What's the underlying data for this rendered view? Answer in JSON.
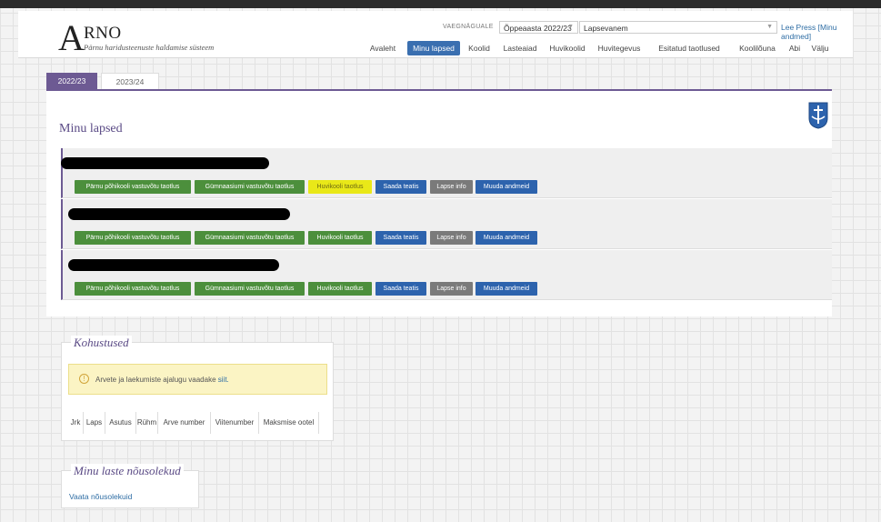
{
  "app": {
    "logo_letter": "A",
    "logo_name": "RNO",
    "subtitle": "Pärnu haridusteenuste haldamise süsteem"
  },
  "view": {
    "label": "VAEGNÄGUALE",
    "year": "Õppeaasta 2022/23",
    "role": "Lapsevanem",
    "user": "Lee Press [Minu andmed]"
  },
  "nav": [
    "Avaleht",
    "Minu lapsed",
    "Koolid",
    "Lasteaiad",
    "Huvikoolid",
    "Huvitegevus",
    "Esitatud taotlused",
    "Koolilõuna",
    "Abi",
    "Välju"
  ],
  "tabs": [
    "2022/23",
    "2023/24"
  ],
  "page_title": "Minu lapsed",
  "buttons": {
    "school": "Pärnu põhikooli vastuvõtu taotlus",
    "gymnasium": "Gümnaasiumi vastuvõtu taotlus",
    "hobby": "Huvikooli taotlus",
    "notice": "Saada teatis",
    "info": "Lapse info",
    "edit": "Muuda andmeid"
  },
  "obligations": {
    "title": "Kohustused",
    "alert_text": "Arvete ja laekumiste ajalugu vaadake",
    "alert_link": "siit.",
    "alert_icon": "!",
    "columns": [
      "Jrk",
      "Laps",
      "Asutus",
      "Rühm",
      "Arve number",
      "Viitenumber",
      "Maksmise ootel"
    ]
  },
  "consents": {
    "title": "Minu laste nõusolekud",
    "link": "Vaata nõusolekuid"
  },
  "colors": {
    "accent": "#6d5a93",
    "nav_active": "#3a6fb0",
    "green": "#4c8f3c",
    "highlight": "#e9e818",
    "blue": "#2d63ad",
    "grey": "#7a7a7a"
  }
}
